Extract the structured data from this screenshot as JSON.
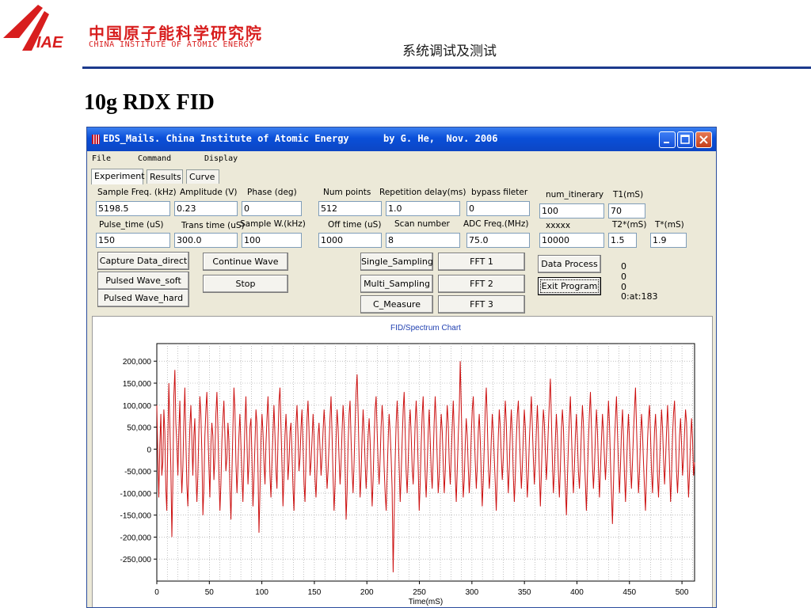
{
  "header": {
    "institute_cn": "中国原子能科学研究院",
    "institute_en": "CHINA INSTITUTE OF ATOMIC ENERGY",
    "section_title": "系统调试及测试",
    "logo_text": "IAE"
  },
  "slide_title": "10g RDX FID",
  "window": {
    "title": "EDS_Mails. China Institute of Atomic Energy      by G. He,  Nov. 2006",
    "menus": [
      "File",
      "Command",
      "Display"
    ],
    "tabs": [
      "Experiment",
      "Results",
      "Curve"
    ],
    "active_tab": "Experiment",
    "fields": [
      {
        "label": "Sample Freq. (kHz)",
        "value": "5198.5"
      },
      {
        "label": "Amplitude (V)",
        "value": "0.23"
      },
      {
        "label": "Phase (deg)",
        "value": "0"
      },
      {
        "label": "Num points",
        "value": "512"
      },
      {
        "label": "Repetition delay(ms)",
        "value": "1.0"
      },
      {
        "label": "bypass fileter",
        "value": "0"
      },
      {
        "label": "num_itinerary",
        "value": "100"
      },
      {
        "label": "T1(mS)",
        "value": "70"
      },
      {
        "label": "Pulse_time (uS)",
        "value": "150"
      },
      {
        "label": "Trans time (uS)",
        "value": "300.0"
      },
      {
        "label": "Sample W.(kHz)",
        "value": "100"
      },
      {
        "label": "Off time (uS)",
        "value": "1000"
      },
      {
        "label": "Scan number",
        "value": "8"
      },
      {
        "label": "ADC Freq.(MHz)",
        "value": "75.0"
      },
      {
        "label": "xxxxx",
        "value": "10000"
      },
      {
        "label": "T2*(mS)",
        "value": "1.5"
      },
      {
        "label": "T*(mS)",
        "value": "1.9"
      }
    ],
    "buttons": {
      "capture": "Capture Data_direct",
      "pulsed_soft": "Pulsed Wave_soft",
      "pulsed_hard": "Pulsed Wave_hard",
      "continue_wave": "Continue Wave",
      "stop": "Stop",
      "single_sampling": "Single_Sampling",
      "multi_sampling": "Multi_Sampling",
      "c_measure": "C_Measure",
      "fft1": "FFT 1",
      "fft2": "FFT 2",
      "fft3": "FFT 3",
      "data_process": "Data Process",
      "exit_program": "Exit Program"
    },
    "status_lines": [
      "0",
      "0",
      "0",
      "0:at:183"
    ]
  },
  "chart_data": {
    "type": "line",
    "title": "FID/Spectrum Chart",
    "xlabel": "Time(mS)",
    "ylabel": "",
    "xlim": [
      0,
      512
    ],
    "ylim": [
      -300000,
      240000
    ],
    "x_ticks": [
      0,
      50,
      100,
      150,
      200,
      250,
      300,
      350,
      400,
      450,
      500
    ],
    "y_ticks": [
      200000,
      150000,
      100000,
      50000,
      0,
      -50000,
      -100000,
      -150000,
      -200000,
      -250000
    ],
    "y_tick_labels": [
      "200,000",
      "150,000",
      "100,000",
      "50,000",
      "0",
      "-50,000",
      "-100,000",
      "-150,000",
      "-200,000",
      "-250,000"
    ],
    "grid": true,
    "series_color": "#cc1111",
    "series": [
      {
        "values": [
          100000,
          -20000,
          -110000,
          10000,
          80000,
          -60000,
          -30000,
          90000,
          40000,
          -90000,
          -140000,
          20000,
          150000,
          60000,
          -40000,
          -200000,
          -80000,
          120000,
          180000,
          60000,
          10000,
          -60000,
          40000,
          110000,
          -20000,
          -100000,
          -40000,
          60000,
          140000,
          20000,
          -80000,
          -130000,
          -30000,
          50000,
          100000,
          20000,
          -60000,
          30000,
          70000,
          -50000,
          -120000,
          -60000,
          40000,
          120000,
          80000,
          -10000,
          -150000,
          -90000,
          30000,
          90000,
          130000,
          40000,
          -40000,
          -110000,
          10000,
          60000,
          30000,
          -70000,
          -20000,
          80000,
          130000,
          50000,
          -60000,
          -140000,
          -80000,
          20000,
          70000,
          110000,
          30000,
          -50000,
          -20000,
          60000,
          20000,
          -90000,
          -160000,
          -60000,
          50000,
          140000,
          90000,
          -30000,
          -100000,
          -40000,
          30000,
          80000,
          10000,
          -60000,
          -120000,
          -30000,
          60000,
          120000,
          20000,
          -80000,
          -30000,
          50000,
          70000,
          -20000,
          -130000,
          -70000,
          10000,
          90000,
          60000,
          -40000,
          -190000,
          -100000,
          20000,
          80000,
          40000,
          -30000,
          -80000,
          10000,
          70000,
          120000,
          40000,
          -60000,
          -110000,
          -30000,
          40000,
          100000,
          30000,
          -50000,
          -90000,
          20000,
          110000,
          140000,
          50000,
          -40000,
          -130000,
          -60000,
          30000,
          80000,
          20000,
          -70000,
          -30000,
          40000,
          60000,
          -10000,
          -90000,
          -140000,
          -40000,
          60000,
          100000,
          30000,
          -50000,
          -20000,
          50000,
          90000,
          10000,
          -80000,
          -120000,
          -20000,
          70000,
          110000,
          40000,
          -60000,
          -30000,
          20000,
          80000,
          30000,
          -70000,
          -110000,
          -40000,
          30000,
          60000,
          0,
          -60000,
          -20000,
          40000,
          90000,
          50000,
          -30000,
          -90000,
          -50000,
          10000,
          70000,
          120000,
          30000,
          -60000,
          -140000,
          -80000,
          20000,
          90000,
          50000,
          -20000,
          -80000,
          -30000,
          40000,
          100000,
          60000,
          -40000,
          -160000,
          -100000,
          10000,
          80000,
          110000,
          20000,
          -50000,
          -100000,
          -30000,
          60000,
          130000,
          170000,
          80000,
          -20000,
          -110000,
          -60000,
          30000,
          90000,
          40000,
          -30000,
          -90000,
          -40000,
          30000,
          70000,
          20000,
          -60000,
          -130000,
          -70000,
          20000,
          90000,
          120000,
          40000,
          -30000,
          -80000,
          -20000,
          50000,
          100000,
          60000,
          -40000,
          -100000,
          -140000,
          -60000,
          20000,
          80000,
          40000,
          -20000,
          -90000,
          -280000,
          -150000,
          -30000,
          60000,
          110000,
          50000,
          -40000,
          -120000,
          -60000,
          20000,
          90000,
          130000,
          40000,
          -50000,
          -100000,
          -30000,
          50000,
          90000,
          30000,
          -40000,
          -80000,
          -20000,
          60000,
          110000,
          50000,
          -40000,
          -140000,
          -80000,
          10000,
          80000,
          120000,
          30000,
          -60000,
          -110000,
          -40000,
          40000,
          90000,
          20000,
          -50000,
          -90000,
          -20000,
          60000,
          120000,
          60000,
          -20000,
          -100000,
          -60000,
          20000,
          80000,
          40000,
          -30000,
          -100000,
          -50000,
          40000,
          100000,
          60000,
          -30000,
          -80000,
          -20000,
          50000,
          110000,
          40000,
          -60000,
          -120000,
          -50000,
          30000,
          90000,
          200000,
          100000,
          -20000,
          -110000,
          -70000,
          10000,
          70000,
          30000,
          -40000,
          -100000,
          -50000,
          30000,
          90000,
          120000,
          40000,
          -30000,
          -90000,
          -40000,
          40000,
          80000,
          20000,
          -60000,
          -130000,
          -70000,
          10000,
          90000,
          140000,
          60000,
          -30000,
          -90000,
          -50000,
          20000,
          80000,
          40000,
          -20000,
          -80000,
          -140000,
          -60000,
          30000,
          90000,
          50000,
          -20000,
          -70000,
          -20000,
          50000,
          110000,
          60000,
          -40000,
          -100000,
          -40000,
          40000,
          90000,
          30000,
          -60000,
          -120000,
          -60000,
          20000,
          80000,
          110000,
          40000,
          -30000,
          -90000,
          -40000,
          30000,
          90000,
          50000,
          -40000,
          -110000,
          -60000,
          20000,
          70000,
          120000,
          50000,
          -20000,
          -80000,
          -30000,
          40000,
          100000,
          40000,
          -50000,
          -130000,
          -60000,
          30000,
          90000,
          60000,
          -10000,
          -70000,
          -20000,
          50000,
          110000,
          160000,
          70000,
          -30000,
          -100000,
          -50000,
          20000,
          80000,
          30000,
          -50000,
          -110000,
          -40000,
          40000,
          90000,
          50000,
          -30000,
          -90000,
          -150000,
          -70000,
          10000,
          70000,
          120000,
          40000,
          -40000,
          -100000,
          -40000,
          30000,
          80000,
          20000,
          -50000,
          -90000,
          -30000,
          40000,
          100000,
          60000,
          -20000,
          -80000,
          -140000,
          -60000,
          20000,
          80000,
          130000,
          50000,
          -30000,
          -90000,
          -40000,
          30000,
          90000,
          40000,
          -40000,
          -110000,
          -50000,
          20000,
          80000,
          40000,
          -20000,
          -70000,
          -20000,
          50000,
          110000,
          60000,
          -30000,
          -100000,
          -170000,
          -80000,
          10000,
          70000,
          120000,
          40000,
          -40000,
          -100000,
          -40000,
          40000,
          90000,
          30000,
          -60000,
          -120000,
          -50000,
          30000,
          80000,
          20000,
          -40000,
          -90000,
          -30000,
          40000,
          90000,
          140000,
          50000,
          -30000,
          -100000,
          -50000,
          20000,
          80000,
          40000,
          -30000,
          -90000,
          -140000,
          -60000,
          20000,
          70000,
          100000,
          30000,
          -50000,
          -100000,
          -30000,
          40000,
          80000,
          20000,
          -60000,
          -110000,
          -40000,
          30000,
          90000,
          50000,
          -20000,
          -80000,
          -30000,
          40000,
          100000,
          40000,
          -40000,
          -120000,
          -60000,
          30000,
          80000,
          110000,
          30000,
          -50000,
          -100000,
          -40000,
          30000,
          70000,
          10000,
          -60000,
          -20000,
          40000,
          90000,
          60000,
          -40000,
          -110000,
          -50000,
          20000,
          70000,
          20000,
          -60000,
          -30000
        ]
      }
    ]
  }
}
